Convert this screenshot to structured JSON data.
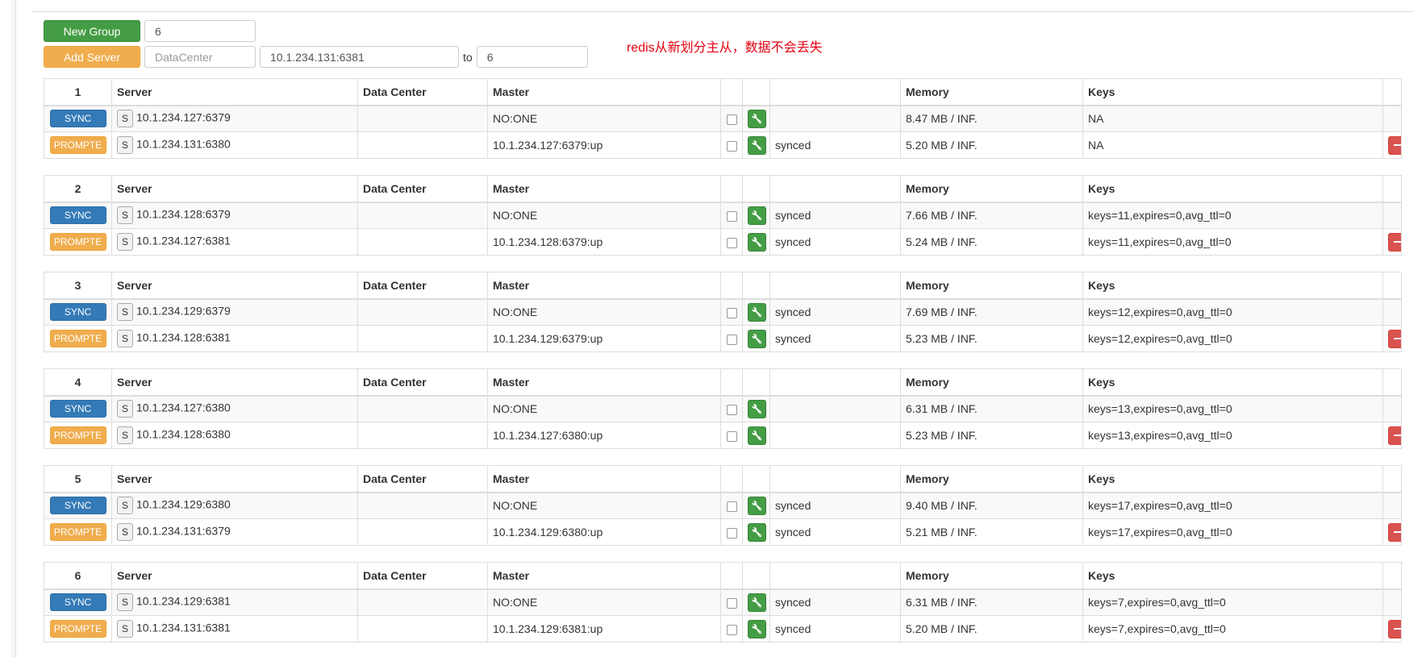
{
  "toolbar": {
    "new_group_label": "New Group",
    "new_group_value": "6",
    "add_server_label": "Add Server",
    "datacenter_placeholder": "DataCenter",
    "server_value": "10.1.234.131:6381",
    "to_label": "to",
    "target_group_value": "6"
  },
  "annotation": "redis从新划分主从，数据不会丢失",
  "columns": {
    "server": "Server",
    "datacenter": "Data Center",
    "master": "Master",
    "memory": "Memory",
    "keys": "Keys"
  },
  "buttons": {
    "sync": "SYNC",
    "promote": "PROMPTE",
    "s": "S"
  },
  "groups": [
    {
      "id": "1",
      "rows": [
        {
          "server": "10.1.234.127:6379",
          "master": "NO:ONE",
          "status": "",
          "memory": "8.47 MB / INF.",
          "keys": "NA"
        },
        {
          "server": "10.1.234.131:6380",
          "master": "10.1.234.127:6379:up",
          "status": "synced",
          "memory": "5.20 MB / INF.",
          "keys": "NA"
        }
      ]
    },
    {
      "id": "2",
      "rows": [
        {
          "server": "10.1.234.128:6379",
          "master": "NO:ONE",
          "status": "synced",
          "memory": "7.66 MB / INF.",
          "keys": "keys=11,expires=0,avg_ttl=0"
        },
        {
          "server": "10.1.234.127:6381",
          "master": "10.1.234.128:6379:up",
          "status": "synced",
          "memory": "5.24 MB / INF.",
          "keys": "keys=11,expires=0,avg_ttl=0"
        }
      ]
    },
    {
      "id": "3",
      "rows": [
        {
          "server": "10.1.234.129:6379",
          "master": "NO:ONE",
          "status": "synced",
          "memory": "7.69 MB / INF.",
          "keys": "keys=12,expires=0,avg_ttl=0"
        },
        {
          "server": "10.1.234.128:6381",
          "master": "10.1.234.129:6379:up",
          "status": "synced",
          "memory": "5.23 MB / INF.",
          "keys": "keys=12,expires=0,avg_ttl=0"
        }
      ]
    },
    {
      "id": "4",
      "rows": [
        {
          "server": "10.1.234.127:6380",
          "master": "NO:ONE",
          "status": "",
          "memory": "6.31 MB / INF.",
          "keys": "keys=13,expires=0,avg_ttl=0"
        },
        {
          "server": "10.1.234.128:6380",
          "master": "10.1.234.127:6380:up",
          "status": "",
          "memory": "5.23 MB / INF.",
          "keys": "keys=13,expires=0,avg_ttl=0"
        }
      ]
    },
    {
      "id": "5",
      "rows": [
        {
          "server": "10.1.234.129:6380",
          "master": "NO:ONE",
          "status": "synced",
          "memory": "9.40 MB / INF.",
          "keys": "keys=17,expires=0,avg_ttl=0"
        },
        {
          "server": "10.1.234.131:6379",
          "master": "10.1.234.129:6380:up",
          "status": "synced",
          "memory": "5.21 MB / INF.",
          "keys": "keys=17,expires=0,avg_ttl=0"
        }
      ]
    },
    {
      "id": "6",
      "rows": [
        {
          "server": "10.1.234.129:6381",
          "master": "NO:ONE",
          "status": "synced",
          "memory": "6.31 MB / INF.",
          "keys": "keys=7,expires=0,avg_ttl=0"
        },
        {
          "server": "10.1.234.131:6381",
          "master": "10.1.234.129:6381:up",
          "status": "synced",
          "memory": "5.20 MB / INF.",
          "keys": "keys=7,expires=0,avg_ttl=0"
        }
      ]
    }
  ]
}
